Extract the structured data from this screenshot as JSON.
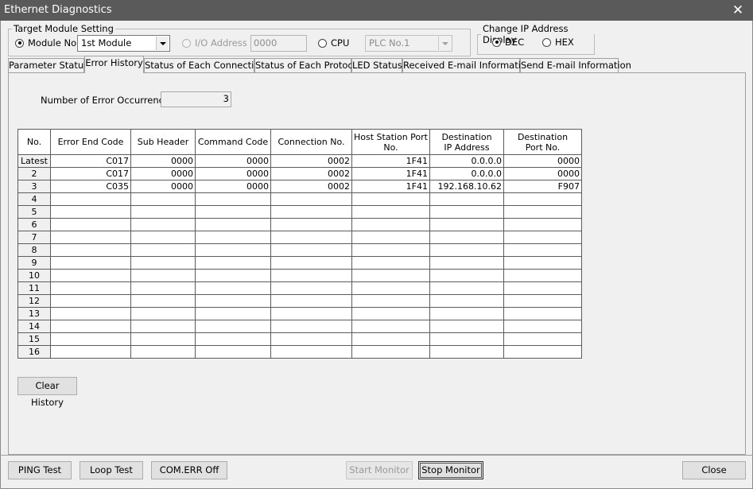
{
  "window": {
    "title": "Ethernet Diagnostics",
    "close_glyph": "✕"
  },
  "target_module": {
    "legend": "Target Module Setting",
    "module_no_label": "Module No.",
    "module_no_value": "1st Module",
    "io_address_label": "I/O Address",
    "io_address_value": "0000",
    "cpu_label": "CPU",
    "cpu_value": "PLC No.1"
  },
  "ip_display": {
    "legend": "Change IP Address Display",
    "dec_label": "DEC",
    "hex_label": "HEX",
    "selected": "DEC"
  },
  "tabs": [
    {
      "label": "Parameter Status"
    },
    {
      "label": "Error History"
    },
    {
      "label": "Status of Each Connection"
    },
    {
      "label": "Status of Each Protocol"
    },
    {
      "label": "LED Status"
    },
    {
      "label": "Received E-mail Information"
    },
    {
      "label": "Send E-mail Information"
    }
  ],
  "active_tab": "Error History",
  "error_history": {
    "occurrences_label": "Number of Error Occurrences",
    "occurrences_value": "3",
    "columns": [
      {
        "l1": "No.",
        "l2": ""
      },
      {
        "l1": "Error End Code",
        "l2": ""
      },
      {
        "l1": "Sub Header",
        "l2": ""
      },
      {
        "l1": "Command Code",
        "l2": ""
      },
      {
        "l1": "Connection No.",
        "l2": ""
      },
      {
        "l1": "Host Station Port",
        "l2": "No."
      },
      {
        "l1": "Destination",
        "l2": "IP Address"
      },
      {
        "l1": "Destination",
        "l2": "Port No."
      }
    ],
    "rows": [
      {
        "no": "Latest",
        "cells": [
          "C017",
          "0000",
          "0000",
          "0002",
          "1F41",
          "0.0.0.0",
          "0000"
        ]
      },
      {
        "no": "2",
        "cells": [
          "C017",
          "0000",
          "0000",
          "0002",
          "1F41",
          "0.0.0.0",
          "0000"
        ]
      },
      {
        "no": "3",
        "cells": [
          "C035",
          "0000",
          "0000",
          "0002",
          "1F41",
          "192.168.10.62",
          "F907"
        ]
      },
      {
        "no": "4",
        "cells": [
          "",
          "",
          "",
          "",
          "",
          "",
          ""
        ]
      },
      {
        "no": "5",
        "cells": [
          "",
          "",
          "",
          "",
          "",
          "",
          ""
        ]
      },
      {
        "no": "6",
        "cells": [
          "",
          "",
          "",
          "",
          "",
          "",
          ""
        ]
      },
      {
        "no": "7",
        "cells": [
          "",
          "",
          "",
          "",
          "",
          "",
          ""
        ]
      },
      {
        "no": "8",
        "cells": [
          "",
          "",
          "",
          "",
          "",
          "",
          ""
        ]
      },
      {
        "no": "9",
        "cells": [
          "",
          "",
          "",
          "",
          "",
          "",
          ""
        ]
      },
      {
        "no": "10",
        "cells": [
          "",
          "",
          "",
          "",
          "",
          "",
          ""
        ]
      },
      {
        "no": "11",
        "cells": [
          "",
          "",
          "",
          "",
          "",
          "",
          ""
        ]
      },
      {
        "no": "12",
        "cells": [
          "",
          "",
          "",
          "",
          "",
          "",
          ""
        ]
      },
      {
        "no": "13",
        "cells": [
          "",
          "",
          "",
          "",
          "",
          "",
          ""
        ]
      },
      {
        "no": "14",
        "cells": [
          "",
          "",
          "",
          "",
          "",
          "",
          ""
        ]
      },
      {
        "no": "15",
        "cells": [
          "",
          "",
          "",
          "",
          "",
          "",
          ""
        ]
      },
      {
        "no": "16",
        "cells": [
          "",
          "",
          "",
          "",
          "",
          "",
          ""
        ]
      }
    ],
    "clear_button": "Clear History"
  },
  "footer": {
    "ping_test": "PING Test",
    "loop_test": "Loop Test",
    "com_err_off": "COM.ERR Off",
    "start_monitor": "Start Monitor",
    "stop_monitor": "Stop Monitor",
    "close": "Close"
  }
}
